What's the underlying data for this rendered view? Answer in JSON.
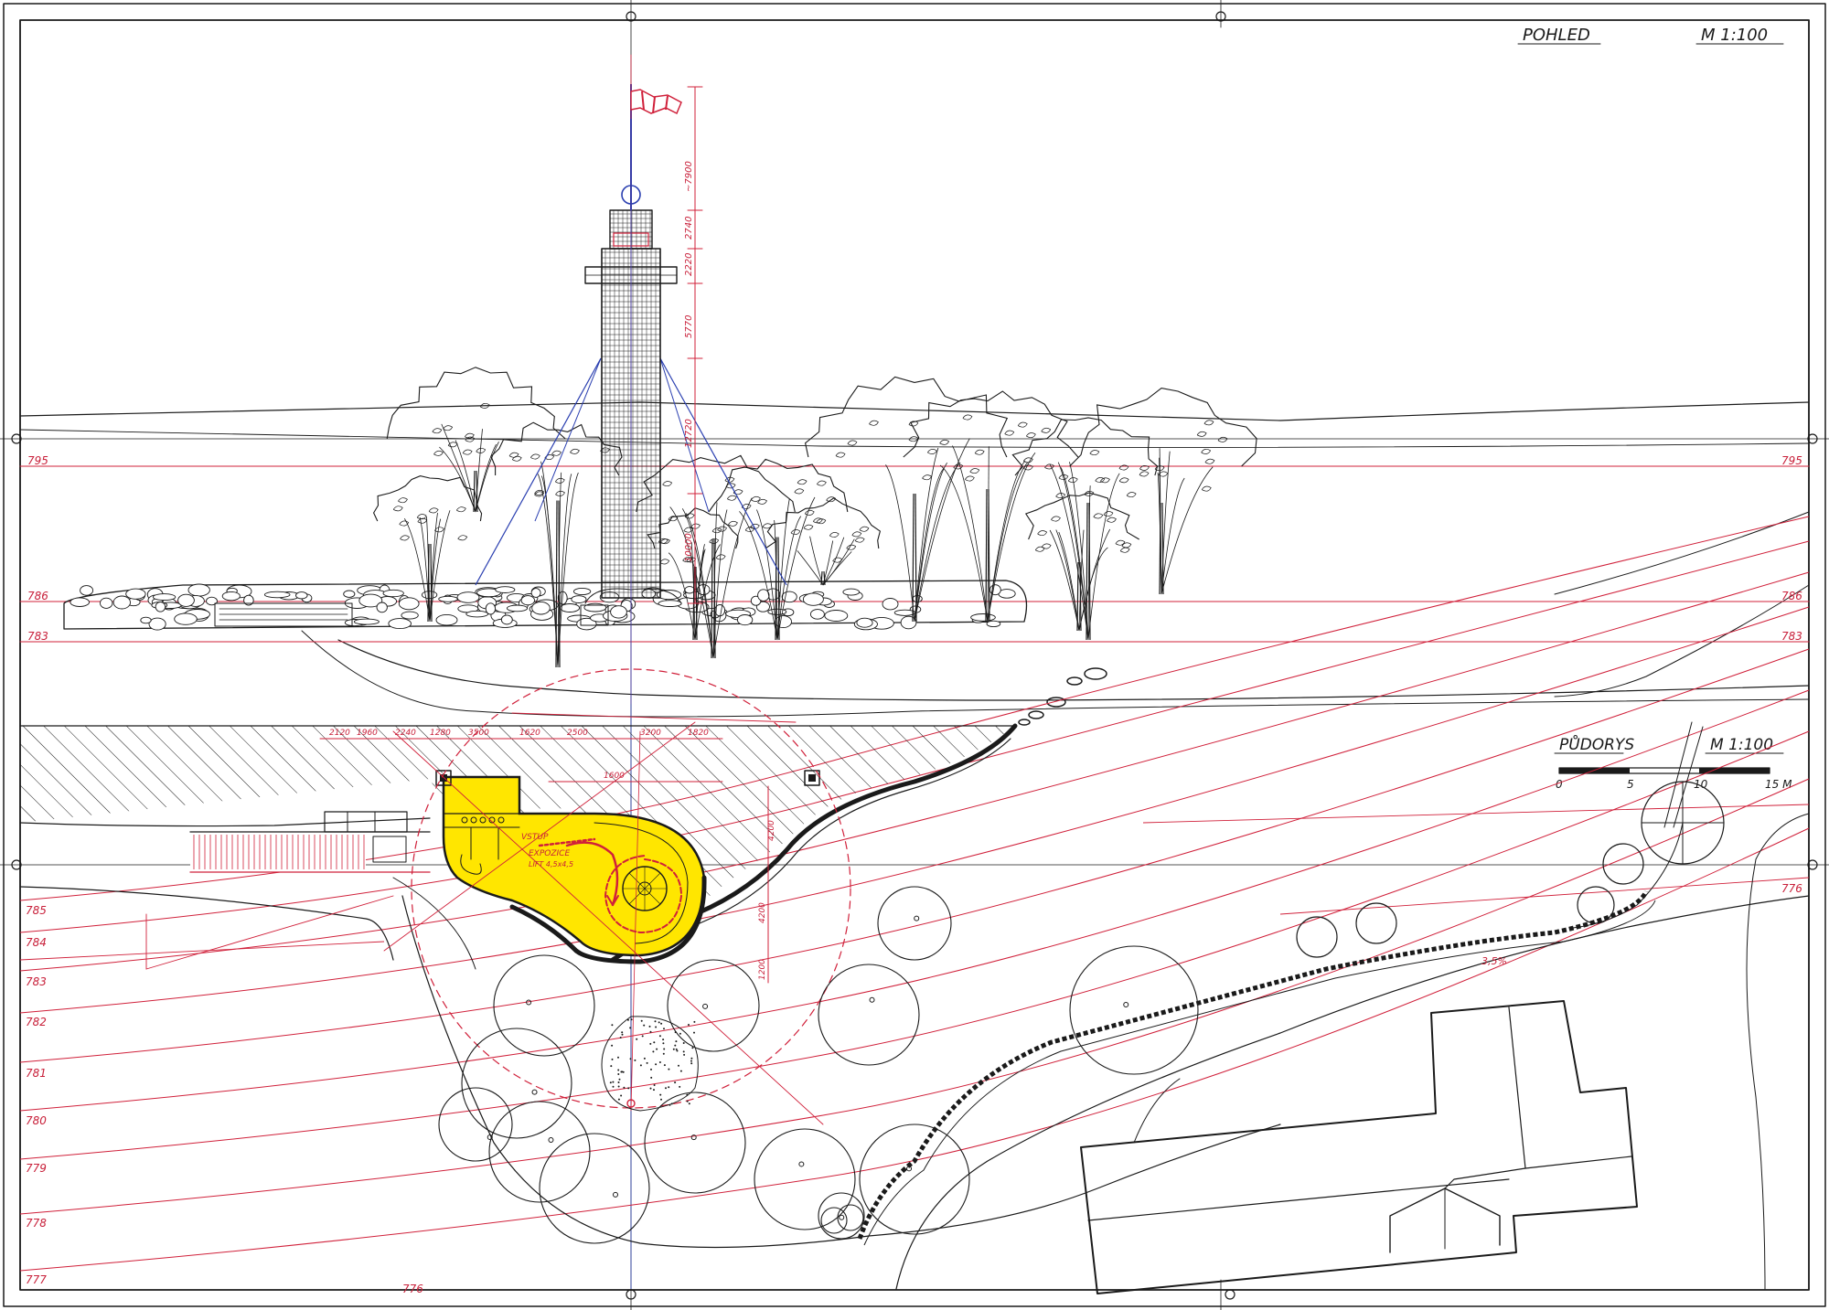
{
  "titles": {
    "elevation_label": "POHLED",
    "elevation_scale": "M 1:100",
    "plan_label": "PŮDORYS",
    "plan_scale": "M 1:100"
  },
  "scale_bar": {
    "ticks": [
      "0",
      "5",
      "10",
      "15 M"
    ]
  },
  "elevation_levels": {
    "left": [
      "795",
      "786",
      "783"
    ],
    "right": [
      "795",
      "786",
      "783"
    ]
  },
  "tower_dimensions": [
    "~7900",
    "2740",
    "2220",
    "5770",
    "12720",
    "10000"
  ],
  "plan_contours": {
    "left": [
      "785",
      "784",
      "783",
      "782",
      "781",
      "780",
      "779",
      "778",
      "777"
    ],
    "right": [
      "776"
    ],
    "bottom": [
      "776"
    ]
  },
  "plan_dimensions": [
    "2120",
    "1960",
    "2240",
    "1280",
    "3500",
    "1620",
    "2500",
    "3200",
    "1820",
    "1600",
    "4200",
    "4200",
    "1200"
  ],
  "plan_notes": {
    "building_note_1": "VSTUP",
    "building_note_2": "EXPOZICE",
    "building_note_3": "LIFT 4,5x4,5",
    "path_note": "3,5%"
  },
  "colors": {
    "ink": "#1a1a1a",
    "red_lines": "#d0203a",
    "blue_lines": "#2a3fb0",
    "highlight": "#ffe600",
    "paper": "#ffffff"
  }
}
